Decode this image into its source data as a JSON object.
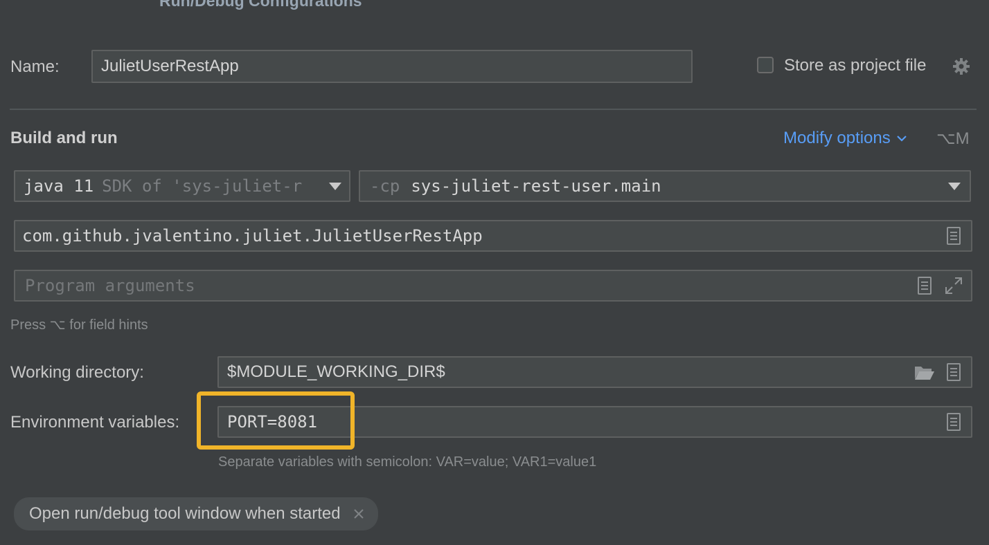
{
  "dialog": {
    "title": "Run/Debug Configurations"
  },
  "name_row": {
    "label": "Name:",
    "value": "JulietUserRestApp",
    "store_label": "Store as project file",
    "store_checked": false,
    "icons": {
      "settings": "gear-icon"
    }
  },
  "build": {
    "section_title": "Build and run",
    "modify_options": "Modify options",
    "modify_shortcut": "⌥M",
    "jre": {
      "main": "java 11",
      "detail": "SDK of 'sys-juliet-r"
    },
    "classpath": {
      "prefix": "-cp",
      "value": "sys-juliet-rest-user.main"
    },
    "main_class": "com.github.jvalentino.juliet.JulietUserRestApp",
    "program_args_placeholder": "Program arguments",
    "field_hint": "Press ⌥ for field hints"
  },
  "working_dir": {
    "label": "Working directory:",
    "value": "$MODULE_WORKING_DIR$"
  },
  "env": {
    "label": "Environment variables:",
    "value": "PORT=8081",
    "hint": "Separate variables with semicolon: VAR=value; VAR1=value1"
  },
  "chip": {
    "label": "Open run/debug tool window when started"
  },
  "colors": {
    "accent_link": "#589df6",
    "highlight": "#f0b429",
    "background": "#3c3f41"
  }
}
